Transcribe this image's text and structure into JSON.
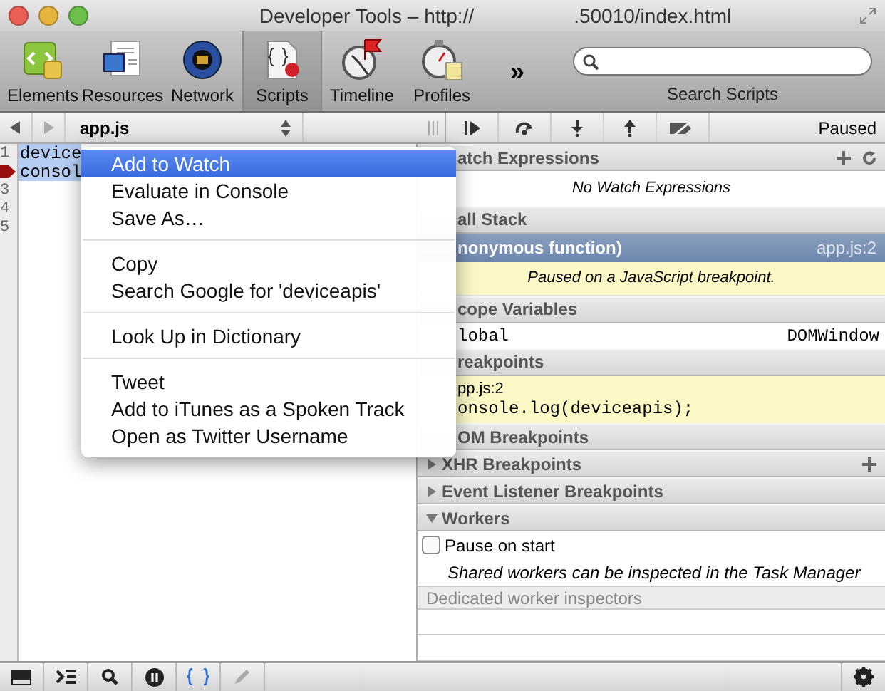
{
  "window": {
    "title": "Developer Tools – http://",
    "title_end": ".50010/index.html"
  },
  "toolbar": {
    "tabs": [
      {
        "label": "Elements",
        "kind": "elements",
        "selected": false
      },
      {
        "label": "Resources",
        "kind": "resources",
        "selected": false
      },
      {
        "label": "Network",
        "kind": "network",
        "selected": false
      },
      {
        "label": "Scripts",
        "kind": "scripts",
        "selected": true
      },
      {
        "label": "Timeline",
        "kind": "timeline",
        "selected": false
      },
      {
        "label": "Profiles",
        "kind": "profiles",
        "selected": false
      }
    ],
    "overflow": "»",
    "search_label": "Search Scripts"
  },
  "script_bar": {
    "file": "app.js",
    "status": "Paused"
  },
  "editor": {
    "lines": [
      {
        "number": "1",
        "code": "device",
        "selected": true,
        "breakpoint": false
      },
      {
        "code": "consol",
        "selected": true,
        "breakpoint": true
      },
      {
        "number": "3",
        "selected": false,
        "breakpoint": false
      },
      {
        "number": "4",
        "selected": false,
        "breakpoint": false
      },
      {
        "number": "5",
        "selected": false,
        "breakpoint": false
      }
    ]
  },
  "sidebar": {
    "rows": [
      {
        "kind": "header",
        "title": "atch Expressions",
        "add_button": true,
        "refresh_button": true
      },
      {
        "kind": "message",
        "text": "No Watch Expressions"
      },
      {
        "kind": "header",
        "title": "all Stack"
      },
      {
        "kind": "frame",
        "name": "nonymous function)",
        "location": "app.js:2",
        "selected": true
      },
      {
        "kind": "notice",
        "text": "Paused on a JavaScript breakpoint."
      },
      {
        "kind": "header",
        "title": "cope Variables"
      },
      {
        "kind": "property",
        "name": "lobal",
        "value": "DOMWindow"
      },
      {
        "kind": "header",
        "title": "reakpoints"
      },
      {
        "kind": "breakpoint",
        "location": "pp.js:2",
        "code": "onsole.log(deviceapis);"
      },
      {
        "kind": "header",
        "title": "OM Breakpoints"
      },
      {
        "kind": "header",
        "title": "XHR Breakpoints",
        "expanded": false,
        "add_button": true
      },
      {
        "kind": "header",
        "title": "Event Listener Breakpoints",
        "expanded": false
      },
      {
        "kind": "header",
        "title": "Workers",
        "expanded": true
      },
      {
        "kind": "checkbox",
        "label": "Pause on start",
        "checked": false
      },
      {
        "kind": "note",
        "text": "Shared workers can be inspected in the Task Manager"
      },
      {
        "kind": "subheader",
        "title": "Dedicated worker inspectors"
      }
    ]
  },
  "context_menu": {
    "groups": [
      [
        {
          "label": "Add to Watch",
          "selected": true
        },
        {
          "label": "Evaluate in Console",
          "selected": false
        },
        {
          "label": "Save As…",
          "selected": false
        }
      ],
      [
        {
          "label": "Copy",
          "selected": false
        },
        {
          "label": "Search Google for 'deviceapis'",
          "selected": false
        }
      ],
      [
        {
          "label": "Look Up in Dictionary",
          "selected": false
        }
      ],
      [
        {
          "label": "Tweet",
          "selected": false
        },
        {
          "label": "Add to iTunes as a Spoken Track",
          "selected": false
        },
        {
          "label": "Open as Twitter Username",
          "selected": false
        }
      ]
    ]
  }
}
